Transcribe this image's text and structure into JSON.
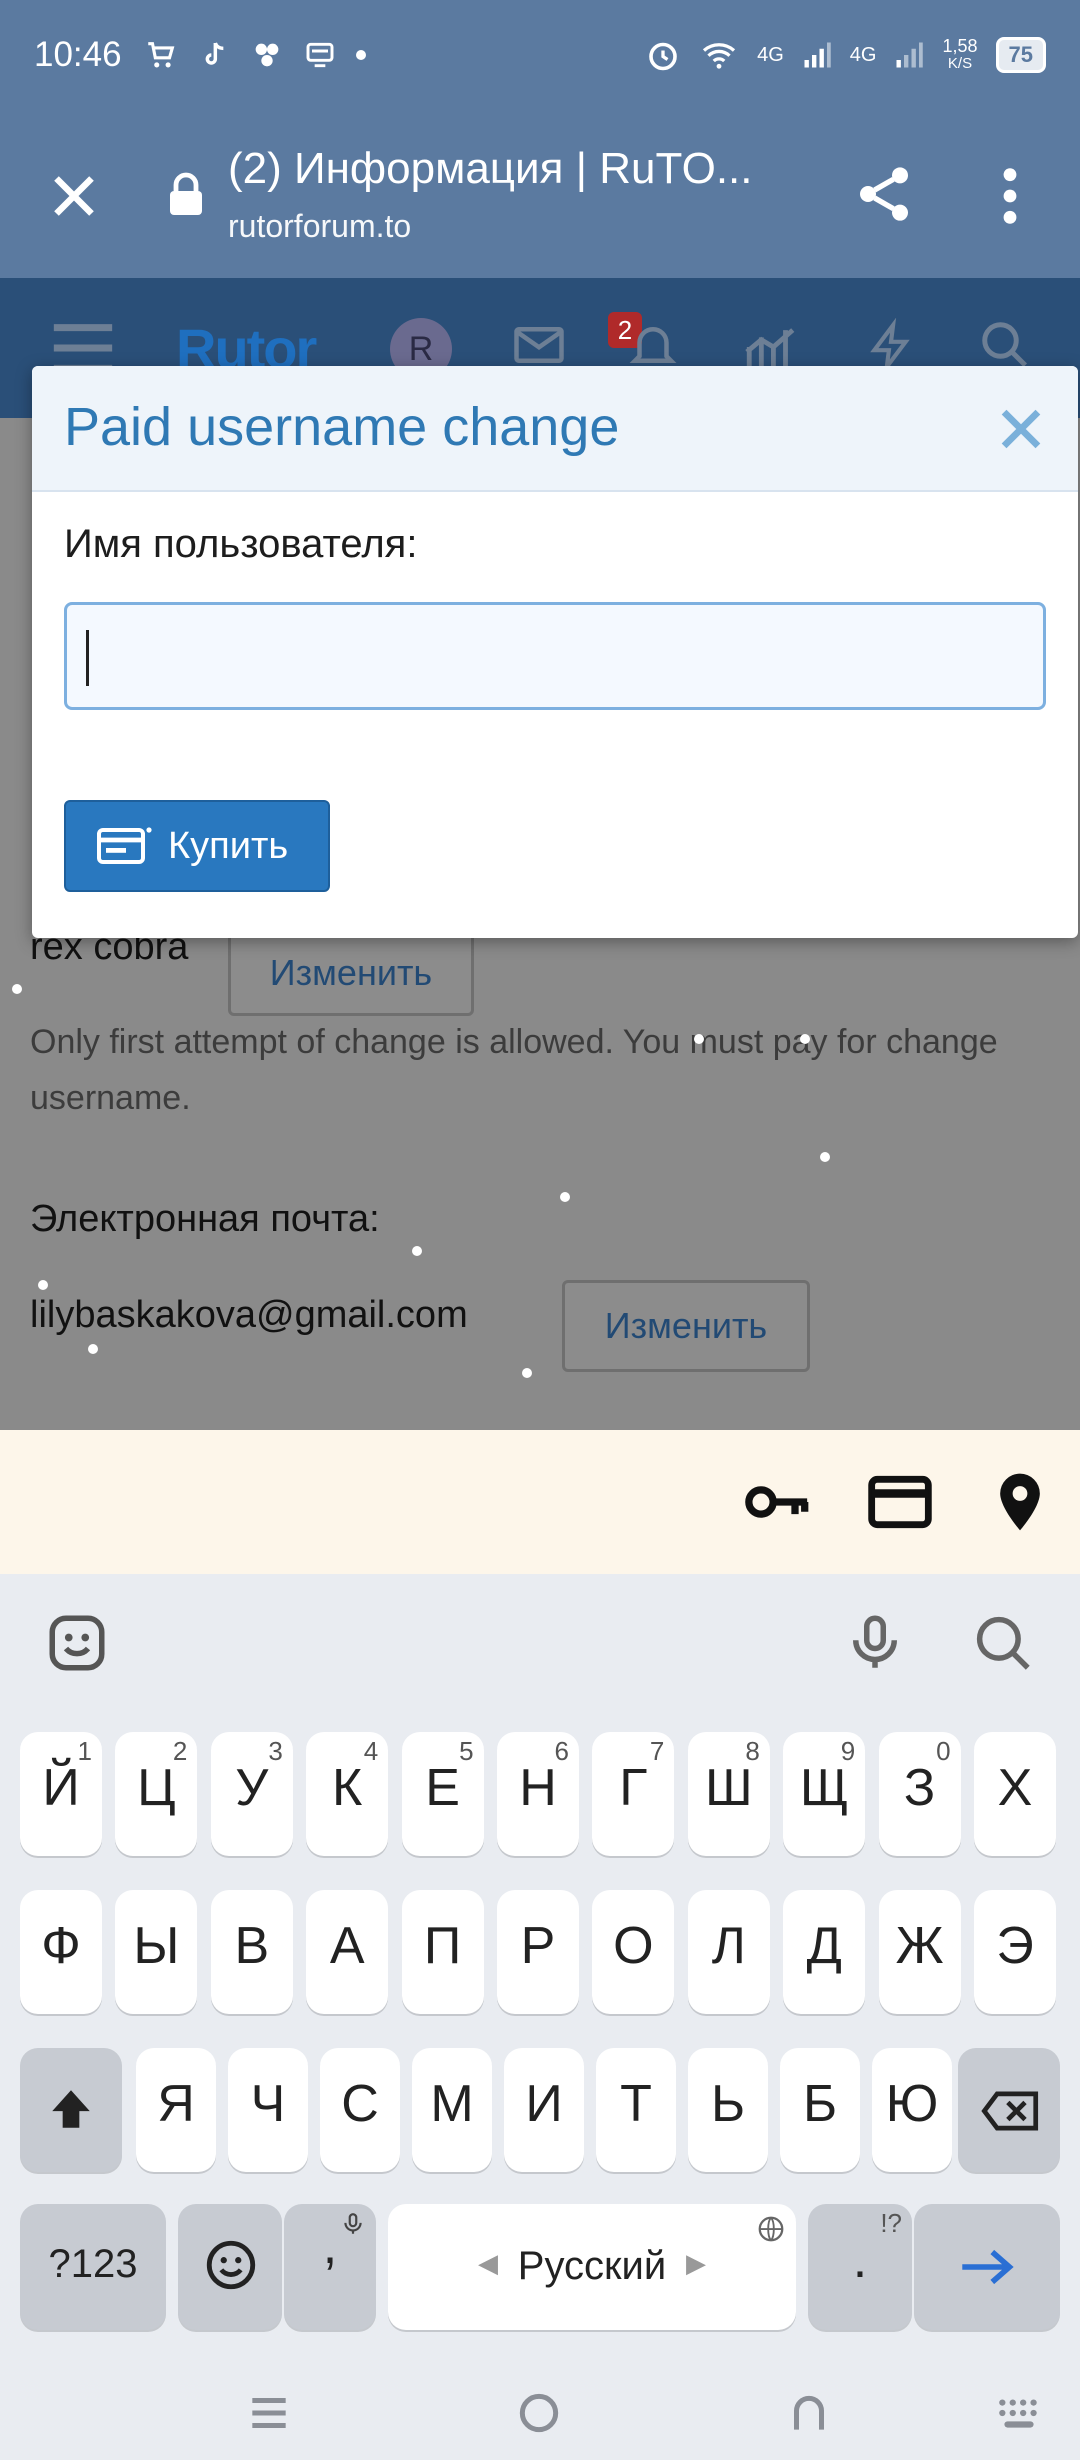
{
  "status_bar": {
    "time": "10:46",
    "net_speed_value": "1,58",
    "net_speed_unit": "K/S",
    "battery": "75",
    "signal_1": "4G",
    "signal_2": "4G"
  },
  "browser": {
    "page_title": "(2) Информация | RuTO...",
    "url": "rutorforum.to"
  },
  "site_nav": {
    "logo_text": "Rutor",
    "avatar_letter": "R",
    "notification_count": "2"
  },
  "page": {
    "username": "rex cobra",
    "change_label": "Изменить",
    "hint": "Only first attempt of change is allowed. You must pay for change username.",
    "email_label": "Электронная почта:",
    "email": "lilybaskakova@gmail.com",
    "email_change_label": "Изменить"
  },
  "modal": {
    "title": "Paid username change",
    "field_label": "Имя пользователя:",
    "field_value": "",
    "buy_label": "Купить"
  },
  "keyboard": {
    "row1": [
      {
        "ch": "Й",
        "num": "1"
      },
      {
        "ch": "Ц",
        "num": "2"
      },
      {
        "ch": "У",
        "num": "3"
      },
      {
        "ch": "К",
        "num": "4"
      },
      {
        "ch": "Е",
        "num": "5"
      },
      {
        "ch": "Н",
        "num": "6"
      },
      {
        "ch": "Г",
        "num": "7"
      },
      {
        "ch": "Ш",
        "num": "8"
      },
      {
        "ch": "Щ",
        "num": "9"
      },
      {
        "ch": "З",
        "num": "0"
      },
      {
        "ch": "Х",
        "num": ""
      }
    ],
    "row2": [
      "Ф",
      "Ы",
      "В",
      "А",
      "П",
      "Р",
      "О",
      "Л",
      "Д",
      "Ж",
      "Э"
    ],
    "row3": [
      "Я",
      "Ч",
      "С",
      "М",
      "И",
      "Т",
      "Ь",
      "Б",
      "Ю"
    ],
    "sym_label": "?123",
    "comma": ",",
    "space_label": "Русский",
    "period": ".",
    "period_hint": "!?"
  }
}
